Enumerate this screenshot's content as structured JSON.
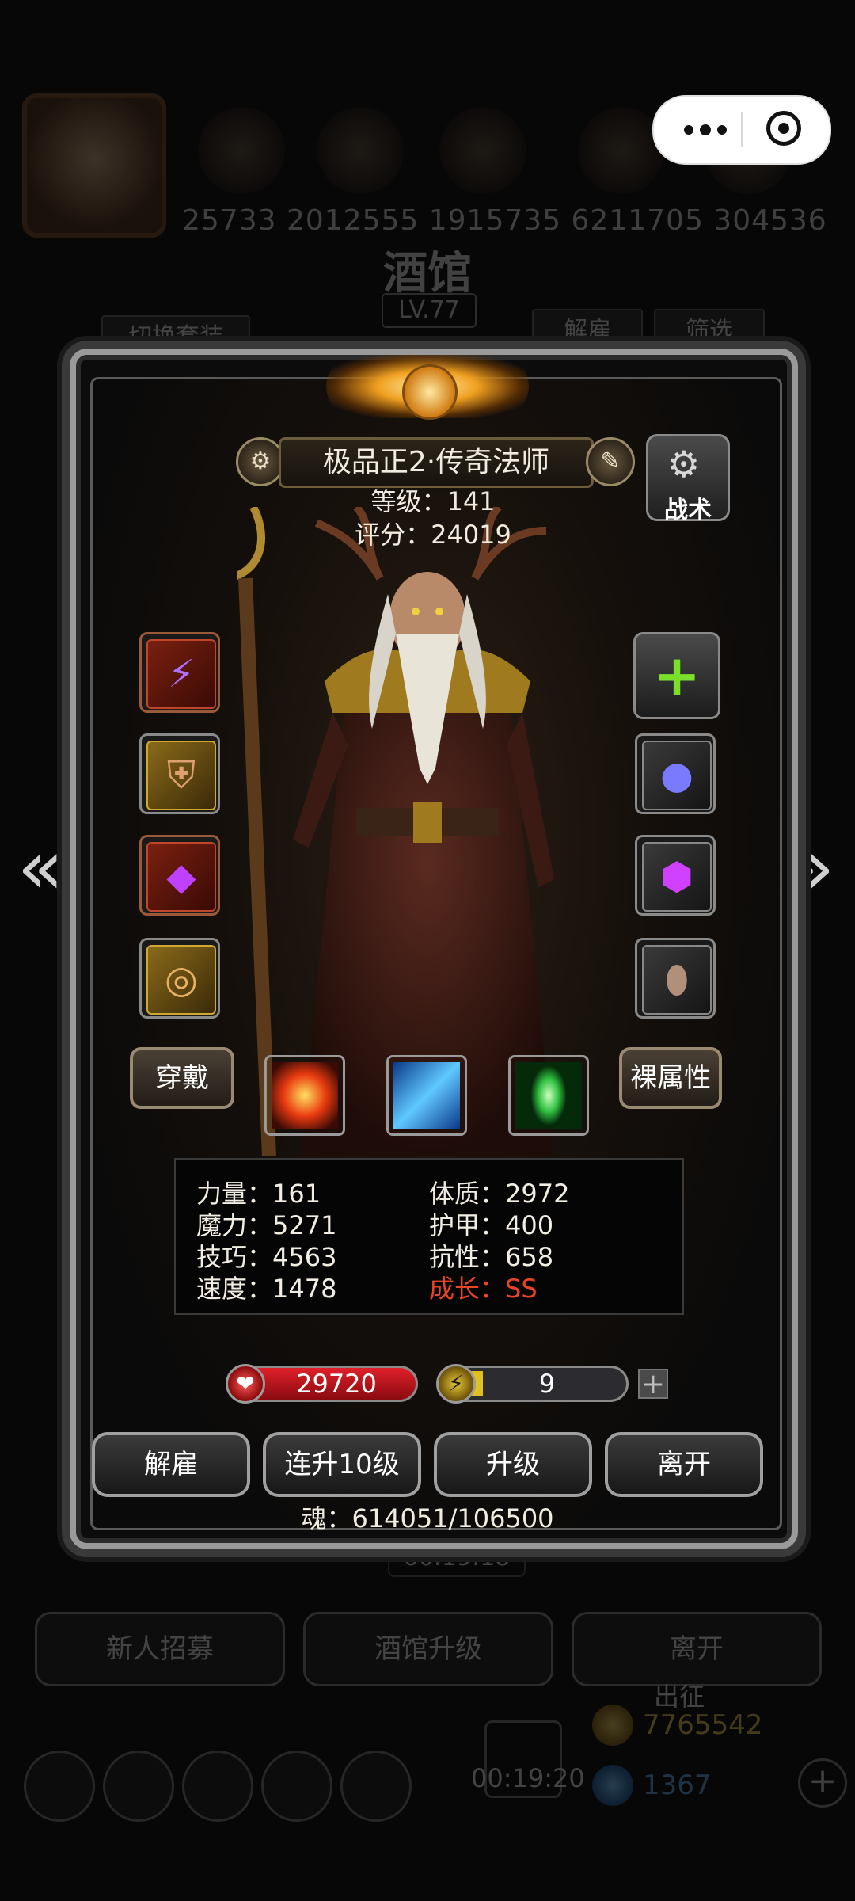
{
  "background": {
    "score_numbers": "25733 2012555 1915735 6211705 304536",
    "tavern_title": "酒馆",
    "tavern_level": "LV.77",
    "switch_outfit_label": "切换套装",
    "dismiss_label": "解雇",
    "filter_label": "筛选",
    "timer": "00:19:18",
    "recruit_label": "新人招募",
    "upgrade_tavern_label": "酒馆升级",
    "leave_label": "离开",
    "expedition_label": "出征",
    "gold": "7765542",
    "gems": "1367",
    "bottom_timer": "00:19:20"
  },
  "capsule": {
    "more_icon": "more-dots-icon",
    "close_icon": "target-circle-icon"
  },
  "hero": {
    "name": "极品正2·传奇法师",
    "level_text": "等级：141",
    "score_text": "评分：24019",
    "tactic_label": "战术"
  },
  "equipment_left": [
    {
      "name": "staff",
      "icon": "⚡",
      "rarity": "red"
    },
    {
      "name": "armor",
      "icon": "🛡",
      "rarity": "gold"
    },
    {
      "name": "amulet",
      "icon": "💎",
      "rarity": "red"
    },
    {
      "name": "ring",
      "icon": "💍",
      "rarity": "gold"
    }
  ],
  "equipment_right": [
    {
      "name": "add",
      "icon": "+",
      "rarity": "gray"
    },
    {
      "name": "orb",
      "icon": "🔮",
      "rarity": "gray"
    },
    {
      "name": "gem",
      "icon": "💠",
      "rarity": "gray"
    },
    {
      "name": "shell",
      "icon": "🐚",
      "rarity": "gray"
    }
  ],
  "buttons": {
    "wear": "穿戴",
    "bare_attributes": "裸属性"
  },
  "skills": [
    "fire-burst",
    "ice-shards",
    "green-light"
  ],
  "stats": {
    "strength": "力量：161",
    "magic": "魔力：5271",
    "skill": "技巧：4563",
    "speed": "速度：1478",
    "constitution": "体质：2972",
    "armor": "护甲：400",
    "resistance": "抗性：658",
    "growth": "成长：SS"
  },
  "bars": {
    "hp": "29720",
    "energy": "9",
    "energy_fill_fraction": 0.08
  },
  "actions": {
    "dismiss": "解雇",
    "level_up_10": "连升10级",
    "upgrade": "升级",
    "leave": "离开"
  },
  "soul": "魂：614051/106500",
  "colors": {
    "accent_gold": "#d8a030",
    "growth_red": "#e8442a",
    "hp_red": "#e0202a",
    "energy_yellow": "#e0c020"
  }
}
